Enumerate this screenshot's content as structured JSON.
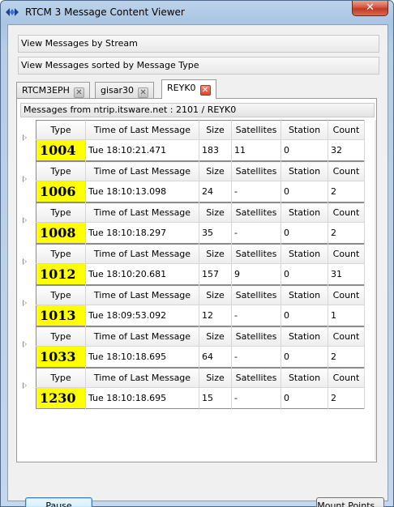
{
  "window": {
    "title": "RTCM 3 Message Content Viewer",
    "close_glyph": "✕",
    "icon": "diamond-arrows-icon"
  },
  "sections": {
    "by_stream": "View Messages by Stream",
    "by_type": "View Messages sorted by Message Type"
  },
  "tabs": [
    {
      "label": "RTCM3EPH",
      "active": false
    },
    {
      "label": "gisar30",
      "active": false
    },
    {
      "label": "REYK0",
      "active": true
    }
  ],
  "tab_close_glyph": "✕",
  "panel": {
    "header": "Messages from ntrip.itsware.net : 2101 / REYK0"
  },
  "columns": [
    "Type",
    "Time of Last Message",
    "Size",
    "Satellites",
    "Station",
    "Count"
  ],
  "messages": [
    {
      "type": "1004",
      "time": "Tue 18:10:21.471",
      "size": "183",
      "satellites": "11",
      "station": "0",
      "count": "32"
    },
    {
      "type": "1006",
      "time": "Tue 18:10:13.098",
      "size": "24",
      "satellites": "-",
      "station": "0",
      "count": "2"
    },
    {
      "type": "1008",
      "time": "Tue 18:10:18.297",
      "size": "35",
      "satellites": "-",
      "station": "0",
      "count": "2"
    },
    {
      "type": "1012",
      "time": "Tue 18:10:20.681",
      "size": "157",
      "satellites": "9",
      "station": "0",
      "count": "31"
    },
    {
      "type": "1013",
      "time": "Tue 18:09:53.092",
      "size": "12",
      "satellites": "-",
      "station": "0",
      "count": "1"
    },
    {
      "type": "1033",
      "time": "Tue 18:10:18.695",
      "size": "64",
      "satellites": "-",
      "station": "0",
      "count": "2"
    },
    {
      "type": "1230",
      "time": "Tue 18:10:18.695",
      "size": "15",
      "satellites": "-",
      "station": "0",
      "count": "2"
    }
  ],
  "buttons": {
    "pause": "Pause",
    "mount_points": "Mount Points..."
  },
  "colors": {
    "type_highlight": "#ffff00",
    "close_button": "#c8452b",
    "title_bar": "#b3cce6"
  }
}
